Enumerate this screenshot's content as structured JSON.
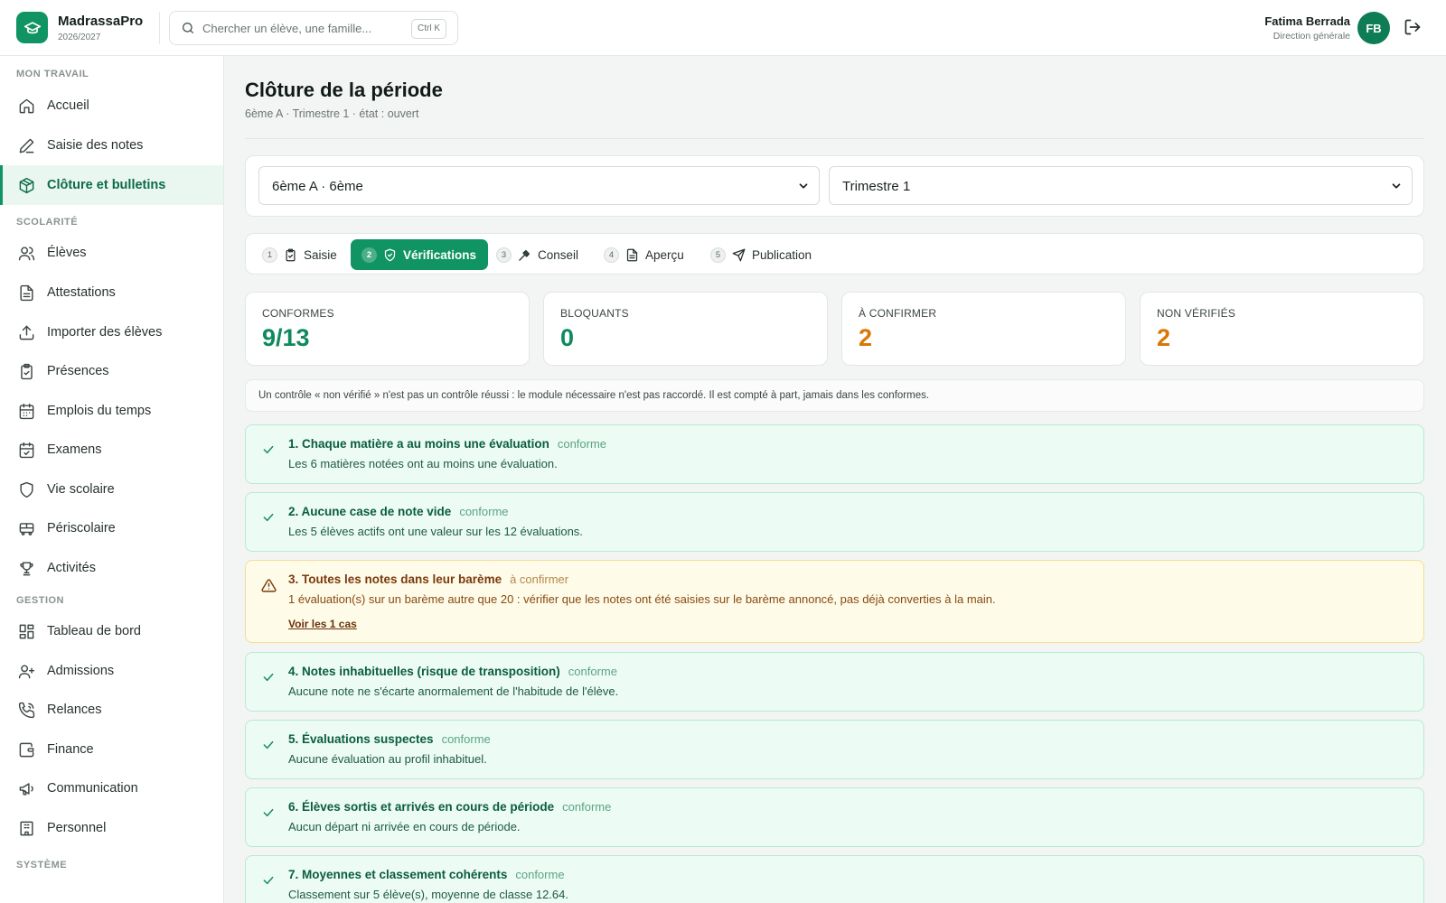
{
  "app": {
    "name": "MadrassaPro",
    "year": "2026/2027"
  },
  "search": {
    "placeholder": "Chercher un élève, une famille...",
    "shortcut": "Ctrl K"
  },
  "user": {
    "name": "Fatima Berrada",
    "role": "Direction générale",
    "initials": "FB"
  },
  "sidebar": {
    "sections": [
      {
        "label": "MON TRAVAIL",
        "items": [
          {
            "label": "Accueil",
            "icon": "home-icon"
          },
          {
            "label": "Saisie des notes",
            "icon": "pencil-icon"
          },
          {
            "label": "Clôture et bulletins",
            "icon": "package-check-icon",
            "active": true
          }
        ]
      },
      {
        "label": "SCOLARITÉ",
        "items": [
          {
            "label": "Élèves",
            "icon": "users-icon"
          },
          {
            "label": "Attestations",
            "icon": "document-icon"
          },
          {
            "label": "Importer des élèves",
            "icon": "upload-icon"
          },
          {
            "label": "Présences",
            "icon": "clipboard-check-icon"
          },
          {
            "label": "Emplois du temps",
            "icon": "calendar-grid-icon"
          },
          {
            "label": "Examens",
            "icon": "calendar-check-icon"
          },
          {
            "label": "Vie scolaire",
            "icon": "shield-icon"
          },
          {
            "label": "Périscolaire",
            "icon": "bus-icon"
          },
          {
            "label": "Activités",
            "icon": "trophy-icon"
          }
        ]
      },
      {
        "label": "GESTION",
        "items": [
          {
            "label": "Tableau de bord",
            "icon": "dashboard-icon"
          },
          {
            "label": "Admissions",
            "icon": "user-plus-icon"
          },
          {
            "label": "Relances",
            "icon": "phone-icon"
          },
          {
            "label": "Finance",
            "icon": "wallet-icon"
          },
          {
            "label": "Communication",
            "icon": "megaphone-icon"
          },
          {
            "label": "Personnel",
            "icon": "building-icon"
          }
        ]
      },
      {
        "label": "SYSTÈME",
        "items": []
      }
    ]
  },
  "page": {
    "title": "Clôture de la période",
    "subtitle": "6ème A · Trimestre 1 · état : ouvert"
  },
  "filters": {
    "class_value": "6ème A · 6ème",
    "period_value": "Trimestre 1"
  },
  "steps": [
    {
      "num": "1",
      "label": "Saisie",
      "icon": "clipboard-icon"
    },
    {
      "num": "2",
      "label": "Vérifications",
      "icon": "shield-check-icon",
      "active": true
    },
    {
      "num": "3",
      "label": "Conseil",
      "icon": "gavel-icon"
    },
    {
      "num": "4",
      "label": "Aperçu",
      "icon": "file-text-icon"
    },
    {
      "num": "5",
      "label": "Publication",
      "icon": "send-icon"
    }
  ],
  "stats": [
    {
      "label": "CONFORMES",
      "value": "9/13",
      "color": "#0f8a5c"
    },
    {
      "label": "BLOQUANTS",
      "value": "0",
      "color": "#0f8a5c"
    },
    {
      "label": "À CONFIRMER",
      "value": "2",
      "color": "#d97706"
    },
    {
      "label": "NON VÉRIFIÉS",
      "value": "2",
      "color": "#d97706"
    }
  ],
  "info_text": "Un contrôle « non vérifié » n'est pas un contrôle réussi : le module nécessaire n'est pas raccordé. Il est compté à part, jamais dans les conformes.",
  "checks": [
    {
      "title": "1. Chaque matière a au moins une évaluation",
      "status": "conforme",
      "kind": "ok",
      "desc": "Les 6 matières notées ont au moins une évaluation."
    },
    {
      "title": "2. Aucune case de note vide",
      "status": "conforme",
      "kind": "ok",
      "desc": "Les 5 élèves actifs ont une valeur sur les 12 évaluations."
    },
    {
      "title": "3. Toutes les notes dans leur barème",
      "status": "à confirmer",
      "kind": "warn",
      "desc": "1 évaluation(s) sur un barème autre que 20 : vérifier que les notes ont été saisies sur le barème annoncé, pas déjà converties à la main.",
      "link": "Voir les 1 cas"
    },
    {
      "title": "4. Notes inhabituelles (risque de transposition)",
      "status": "conforme",
      "kind": "ok",
      "desc": "Aucune note ne s'écarte anormalement de l'habitude de l'élève."
    },
    {
      "title": "5. Évaluations suspectes",
      "status": "conforme",
      "kind": "ok",
      "desc": "Aucune évaluation au profil inhabituel."
    },
    {
      "title": "6. Élèves sortis et arrivés en cours de période",
      "status": "conforme",
      "kind": "ok",
      "desc": "Aucun départ ni arrivée en cours de période."
    },
    {
      "title": "7. Moyennes et classement cohérents",
      "status": "conforme",
      "kind": "ok",
      "desc": "Classement sur 5 élève(s), moyenne de classe 12.64."
    }
  ],
  "colors": {
    "accent": "#109463",
    "warning": "#d97706",
    "ok_bg": "#ecfbf4",
    "warn_bg": "#fefbe9"
  }
}
